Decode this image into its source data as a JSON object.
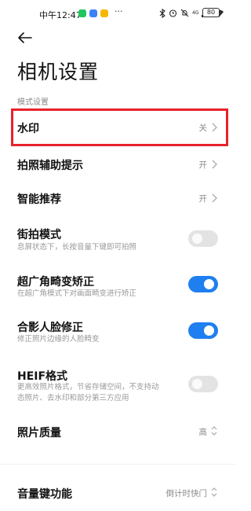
{
  "status_bar": {
    "time": "中午12:47",
    "more": "···",
    "network": "4G",
    "battery": "80",
    "app_icon_colors": [
      "#22c55e",
      "#3b82f6",
      "#f5b800"
    ]
  },
  "header": {
    "back_icon": "arrow-left-icon",
    "title": "相机设置"
  },
  "section": {
    "label": "模式设置"
  },
  "settings": {
    "watermark": {
      "title": "水印",
      "value": "关"
    },
    "assist": {
      "title": "拍照辅助提示",
      "value": "开"
    },
    "smart": {
      "title": "智能推荐",
      "value": "开"
    },
    "street": {
      "title": "街拍模式",
      "subtitle": "息屏状态下，长按音量下键即可拍照",
      "enabled": false
    },
    "ultrawide": {
      "title": "超广角畸变矫正",
      "subtitle": "在超广角模式下对画面畸变进行矫正",
      "enabled": true
    },
    "face": {
      "title": "合影人脸修正",
      "subtitle": "修正照片边缘的人脸畸变",
      "enabled": true
    },
    "heif": {
      "title": "HEIF格式",
      "subtitle_line1": "更高效照片格式，节省存储空间，不支持动",
      "subtitle_line2": "态照片、去水印和部分第三方应用",
      "enabled": false
    },
    "quality": {
      "title": "照片质量",
      "value": "高"
    },
    "volume": {
      "title": "音量键功能",
      "value": "倒计时快门"
    }
  },
  "colors": {
    "toggle_on": "#1f7ff0",
    "toggle_off": "#e3e3e3",
    "highlight": "#e8222a"
  }
}
